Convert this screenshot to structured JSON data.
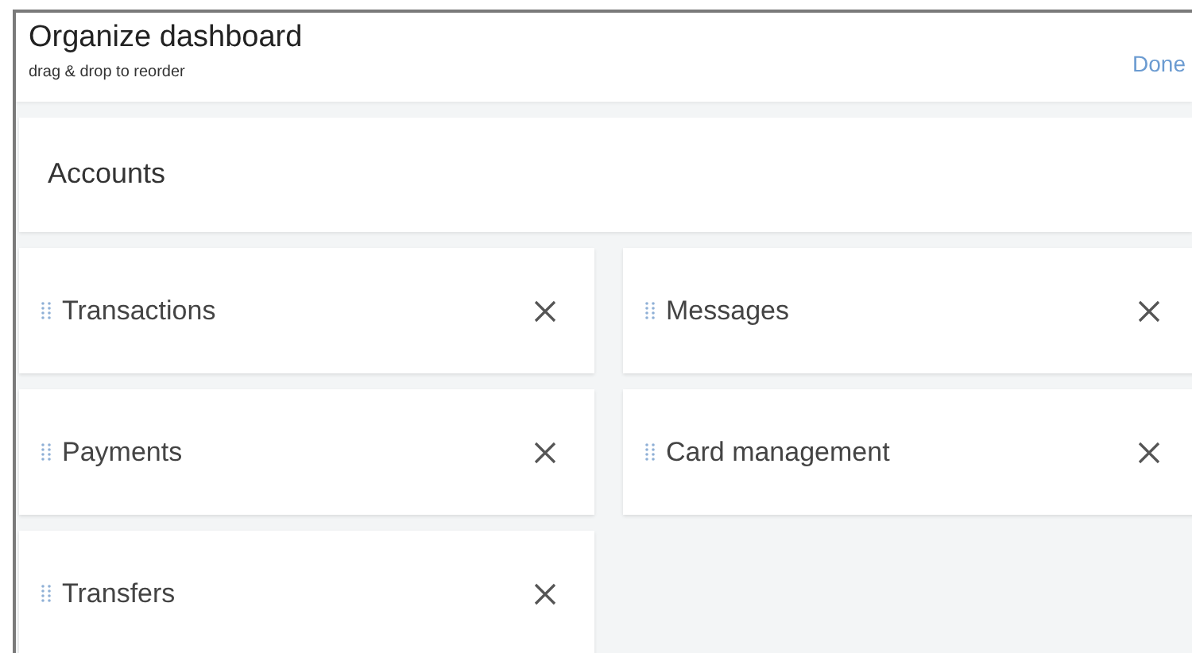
{
  "header": {
    "title": "Organize dashboard",
    "subtitle": "drag & drop to reorder",
    "action": "Done"
  },
  "section": {
    "title": "Accounts"
  },
  "widgets": [
    {
      "label": "Transactions"
    },
    {
      "label": "Messages"
    },
    {
      "label": "Payments"
    },
    {
      "label": "Card management"
    },
    {
      "label": "Transfers"
    }
  ]
}
